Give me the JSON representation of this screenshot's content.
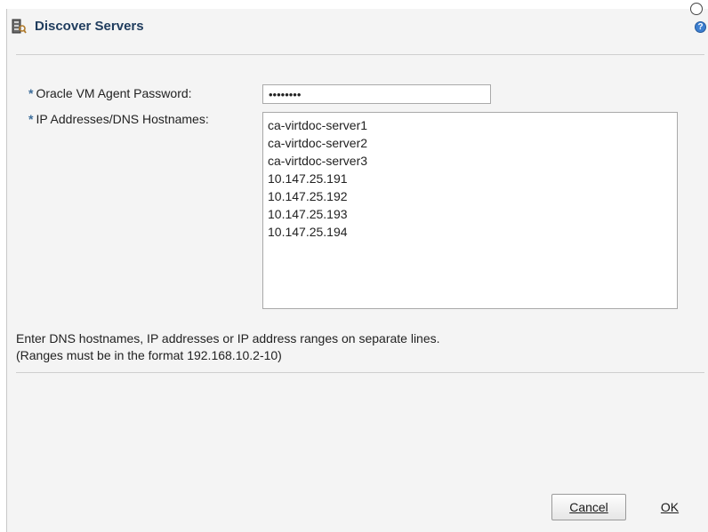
{
  "dialog": {
    "title": "Discover Servers",
    "title_icon": "server-discover-icon",
    "help_icon_glyph": "?"
  },
  "form": {
    "required_marker": "*",
    "password_label": "Oracle VM Agent Password:",
    "password_value": "••••••••",
    "hosts_label": "IP Addresses/DNS Hostnames:",
    "hosts": [
      "ca-virtdoc-server1",
      "ca-virtdoc-server2",
      "ca-virtdoc-server3",
      "10.147.25.191",
      "10.147.25.192",
      "10.147.25.193",
      "10.147.25.194"
    ]
  },
  "help": {
    "line1": "Enter DNS hostnames, IP addresses or IP address ranges on separate lines.",
    "line2": "(Ranges must be in the format 192.168.10.2-10)"
  },
  "buttons": {
    "cancel_label": "Cancel",
    "ok_label": "OK"
  }
}
